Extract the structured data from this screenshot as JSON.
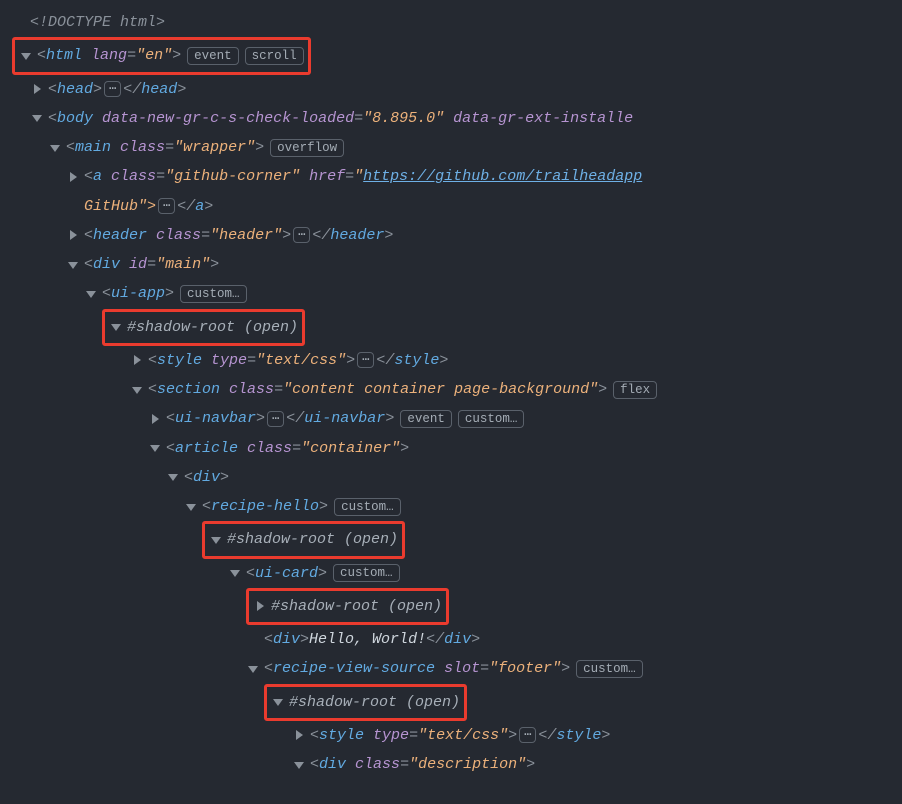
{
  "doctype": "<!DOCTYPE html>",
  "html": {
    "tag": "html",
    "attr_lang_name": "lang",
    "attr_lang_val": "\"en\"",
    "badge_event": "event",
    "badge_scroll": "scroll"
  },
  "head": {
    "tag": "head"
  },
  "body": {
    "tag": "body",
    "attr1_name": "data-new-gr-c-s-check-loaded",
    "attr1_val": "\"8.895.0\"",
    "attr2_name": "data-gr-ext-installe"
  },
  "main": {
    "tag": "main",
    "attr_class_name": "class",
    "attr_class_val": "\"wrapper\"",
    "badge_overflow": "overflow"
  },
  "a": {
    "tag": "a",
    "attr_class_name": "class",
    "attr_class_val": "\"github-corner\"",
    "attr_href_name": "href",
    "attr_href_val": "https://github.com/trailheadapp",
    "line2_text": "GitHub\">"
  },
  "header": {
    "tag": "header",
    "attr_class_name": "class",
    "attr_class_val": "\"header\""
  },
  "divmain": {
    "tag": "div",
    "attr_id_name": "id",
    "attr_id_val": "\"main\""
  },
  "uiapp": {
    "tag": "ui-app",
    "badge": "custom…"
  },
  "shadow1": "#shadow-root (open)",
  "style1": {
    "tag": "style",
    "attr_type_name": "type",
    "attr_type_val": "\"text/css\""
  },
  "section": {
    "tag": "section",
    "attr_class_name": "class",
    "attr_class_val": "\"content container page-background\"",
    "badge_flex": "flex"
  },
  "uinavbar": {
    "tag": "ui-navbar",
    "badge_event": "event",
    "badge_custom": "custom…"
  },
  "article": {
    "tag": "article",
    "attr_class_name": "class",
    "attr_class_val": "\"container\""
  },
  "div_plain": {
    "tag": "div"
  },
  "recipehello": {
    "tag": "recipe-hello",
    "badge": "custom…"
  },
  "shadow2": "#shadow-root (open)",
  "uicard": {
    "tag": "ui-card",
    "badge": "custom…"
  },
  "shadow3": "#shadow-root (open)",
  "divhello": {
    "tag": "div",
    "text": "Hello, World!"
  },
  "recipeview": {
    "tag": "recipe-view-source",
    "attr_slot_name": "slot",
    "attr_slot_val": "\"footer\"",
    "badge": "custom…"
  },
  "shadow4": "#shadow-root (open)",
  "style2": {
    "tag": "style",
    "attr_type_name": "type",
    "attr_type_val": "\"text/css\""
  },
  "divdesc": {
    "tag": "div",
    "attr_class_name": "class",
    "attr_class_val": "\"description\""
  },
  "ellipsis": "⋯"
}
